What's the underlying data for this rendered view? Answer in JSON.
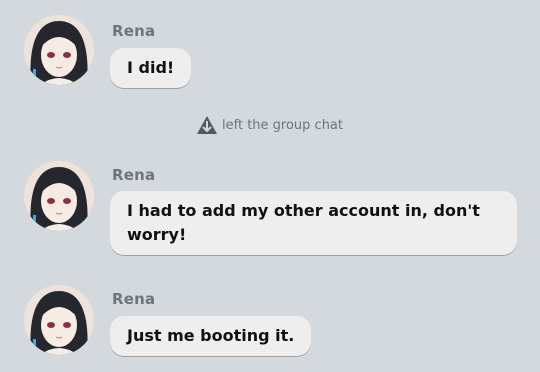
{
  "colors": {
    "background": "#d4d9dd",
    "bubble": "#eeeeee",
    "name": "#6f7478",
    "text": "#111111"
  },
  "messages": [
    {
      "author": "Rena",
      "text": "I did!",
      "avatar_icon": "user-avatar-icon"
    },
    {
      "author": "Rena",
      "text": "I had to add my other account in, don't worry!",
      "avatar_icon": "user-avatar-icon"
    },
    {
      "author": "Rena",
      "text": "Just me booting it.",
      "avatar_icon": "user-avatar-icon"
    }
  ],
  "system_event": {
    "icon": "leave-arrow-icon",
    "text": "left the group chat"
  }
}
